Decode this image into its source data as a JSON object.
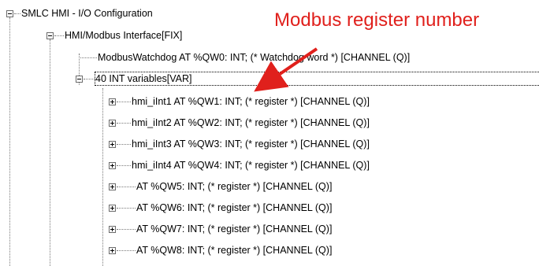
{
  "tree": {
    "root_label": "SMLC HMI - I/O Configuration",
    "interface_label": "HMI/Modbus Interface[FIX]",
    "watchdog_label": "ModbusWatchdog AT %QW0: INT; (* Watchdog word *) [CHANNEL (Q)]",
    "group_label": "40 INT variables[VAR]",
    "items": [
      "hmi_iInt1 AT %QW1: INT; (* register *) [CHANNEL (Q)]",
      "hmi_iInt2 AT %QW2: INT; (* register *) [CHANNEL (Q)]",
      "hmi_iInt3 AT %QW3: INT; (* register *) [CHANNEL (Q)]",
      "hmi_iInt4 AT %QW4: INT; (* register *) [CHANNEL (Q)]",
      "AT %QW5: INT; (* register *) [CHANNEL (Q)]",
      "AT %QW6: INT; (* register *) [CHANNEL (Q)]",
      "AT %QW7: INT; (* register *) [CHANNEL (Q)]",
      "AT %QW8: INT; (* register *) [CHANNEL (Q)]"
    ]
  },
  "annotation": {
    "text": "Modbus register number",
    "color": "#e0201c"
  }
}
